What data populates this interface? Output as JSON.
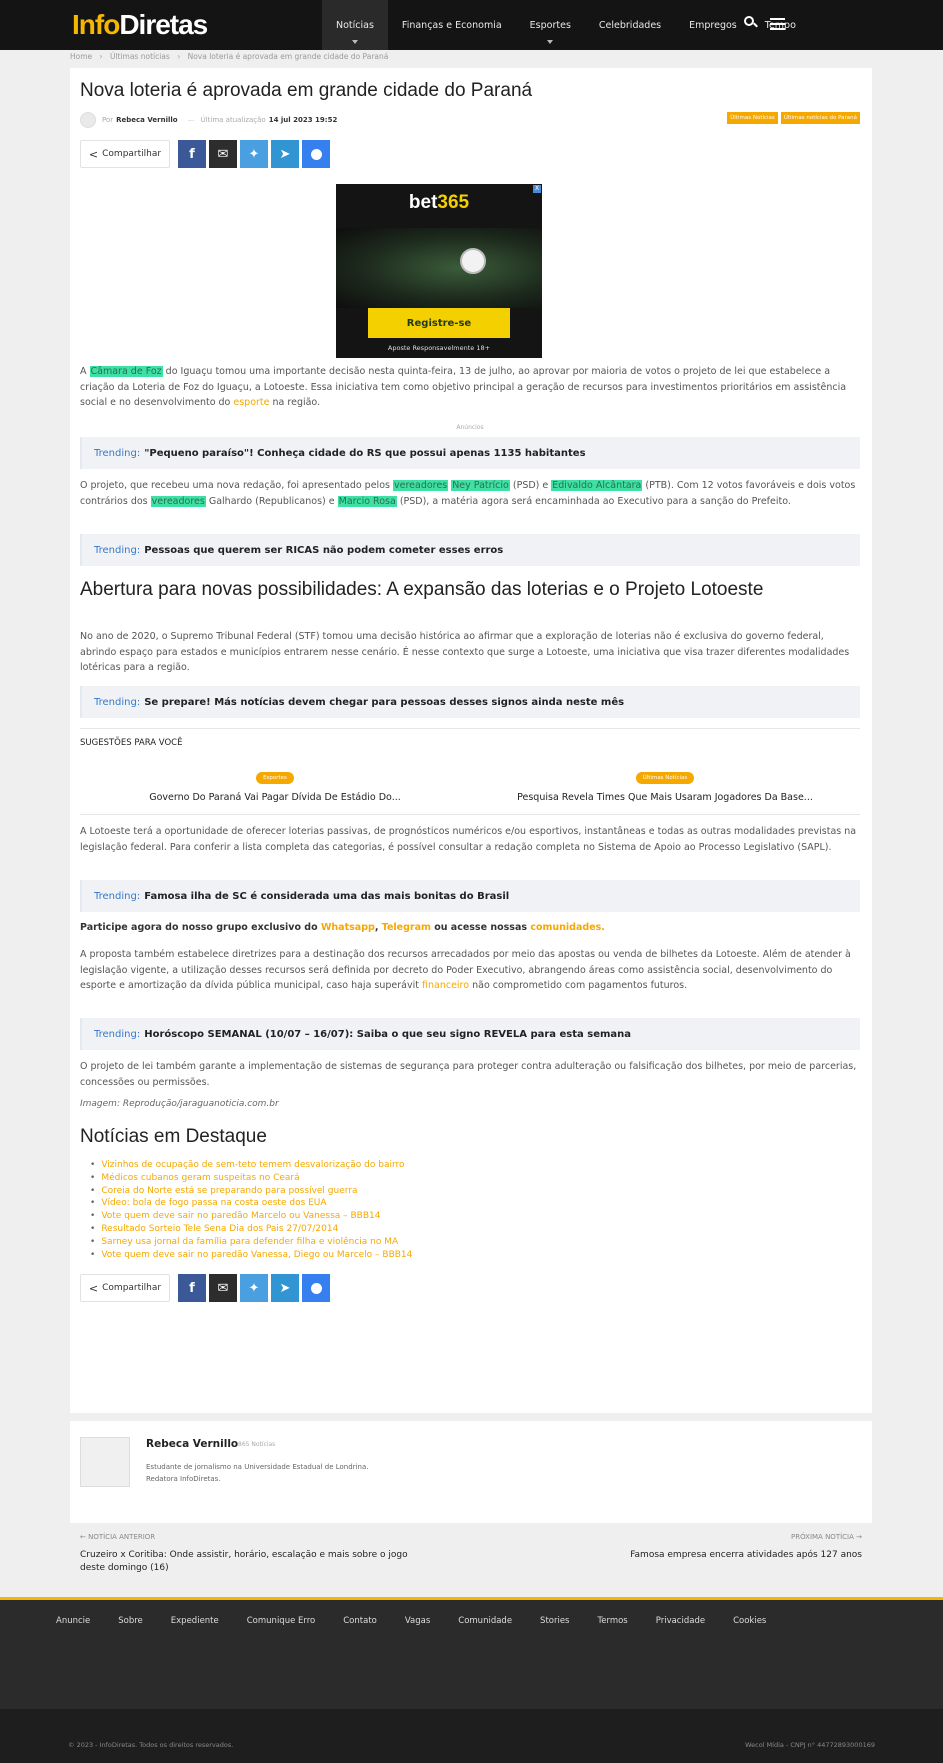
{
  "header": {
    "logo_part1": "Info",
    "logo_part2": "Diretas",
    "nav": [
      "Notícias",
      "Finanças e Economia",
      "Esportes",
      "Celebridades",
      "Empregos",
      "Tempo"
    ],
    "active_nav": "Notícias",
    "icons": [
      "search-icon",
      "hamburger-menu-icon"
    ]
  },
  "breadcrumb": [
    "Home",
    "›",
    "Últimas notícias",
    "›",
    "Nova loteria é aprovada em grande cidade do Paraná"
  ],
  "article": {
    "title": "Nova loteria é aprovada em grande cidade do Paraná",
    "by_prefix": "Por",
    "author": "Rebeca Vernillo",
    "updated_prefix": "Última atualização",
    "updated_date": "14 jul 2023 19:52",
    "tags": [
      "Últimas Notícias",
      "Últimas notícias do Paraná"
    ],
    "share_label": "Compartilhar",
    "p1_a": "A ",
    "p1_hl": "Câmara de Foz",
    "p1_b": " do Iguaçu tomou uma importante decisão nesta quinta-feira, 13 de julho, ao aprovar por maioria de votos o projeto de lei que estabelece a criação da Loteria de Foz do Iguaçu, a Lotoeste. Essa iniciativa tem como objetivo principal a geração de recursos para investimentos prioritários em assistência social e no desenvolvimento do ",
    "p1_link": "esporte",
    "p1_c": " na região.",
    "ads_label": "Anúncios",
    "p2_a": "O projeto, que recebeu uma nova redação, foi apresentado pelos ",
    "p2_hl1": "vereadores",
    "p2_b": " ",
    "p2_hl2": "Ney Patrício",
    "p2_c": " (PSD) e ",
    "p2_hl3": "Edivaldo Alcântara",
    "p2_d": " (PTB). Com 12 votos favoráveis e dois votos contrários dos ",
    "p2_hl4": "vereadores",
    "p2_e": " Galhardo (Republicanos) e ",
    "p2_hl5": "Marcio Rosa",
    "p2_f": " (PSD), a matéria agora será encaminhada ao Executivo para a sanção do Prefeito.",
    "h2": "Abertura para novas possibilidades: A expansão das loterias e o Projeto Lotoeste",
    "p3": "No ano de 2020, o Supremo Tribunal Federal (STF) tomou uma decisão histórica ao afirmar que a exploração de loterias não é exclusiva do governo federal, abrindo espaço para estados e municípios entrarem nesse cenário. É nesse contexto que surge a Lotoeste, uma iniciativa que visa trazer diferentes modalidades lotéricas para a região.",
    "suggestions_title": "SUGESTÕES PARA VOCÊ",
    "suggestions": [
      {
        "badge": "Esportes",
        "title": "Governo Do Paraná Vai Pagar Dívida De Estádio Do..."
      },
      {
        "badge": "Últimas Notícias",
        "title": "Pesquisa Revela Times Que Mais Usaram Jogadores Da Base..."
      }
    ],
    "p4": "A Lotoeste terá a oportunidade de oferecer loterias passivas, de prognósticos numéricos e/ou esportivos, instantâneas e todas as outras modalidades previstas na legislação federal. Para conferir a lista completa das categorias, é possível consultar a redação completa no Sistema de Apoio ao Processo Legislativo (SAPL).",
    "join_a": "Participe agora do nosso grupo exclusivo do ",
    "join_wa": "Whatsapp",
    "join_b": ", ",
    "join_tg": "Telegram",
    "join_c": " ou acesse nossas ",
    "join_com": "comunidades.",
    "p5_a": "A proposta também estabelece diretrizes para a destinação dos recursos arrecadados por meio das apostas ou venda de bilhetes da Lotoeste. Além de atender à legislação vigente, a utilização desses recursos será definida por decreto do Poder Executivo, abrangendo áreas como assistência social, desenvolvimento do esporte e amortização da dívida pública municipal, caso haja superávit ",
    "p5_link": "financeiro",
    "p5_b": " não comprometido com pagamentos futuros.",
    "p6": "O projeto de lei também garante a implementação de sistemas de segurança para proteger contra adulteração ou falsificação dos bilhetes, por meio de parcerias, concessões ou permissões.",
    "credit": "Imagem: Reprodução/jaraguanoticia.com.br"
  },
  "trending": {
    "label": "Trending:",
    "items": [
      "\"Pequeno paraíso\"! Conheça cidade do RS que possui apenas 1135 habitantes",
      "Pessoas que querem ser RICAS não podem cometer esses erros",
      "Se prepare! Más notícias devem chegar para pessoas desses signos ainda neste mês",
      "Famosa ilha de SC é considerada uma das mais bonitas do Brasil",
      "Horóscopo SEMANAL (10/07 – 16/07): Saiba o que seu signo REVELA para esta semana"
    ]
  },
  "ad": {
    "brand_a": "bet",
    "brand_b": "365",
    "cta": "Registre-se",
    "disclaimer": "Aposte Responsavelmente   18+",
    "close": "X"
  },
  "featured": {
    "title": "Notícias em Destaque",
    "items": [
      "Vizinhos de ocupação de sem-teto temem desvalorização do bairro",
      "Médicos cubanos geram suspeitas no Ceará",
      "Coreia do Norte está se preparando para possível guerra",
      "Vídeo: bola de fogo passa na costa oeste dos EUA",
      "Vote quem deve sair no paredão Marcelo ou Vanessa – BBB14",
      "Resultado Sorteio Tele Sena Dia dos Pais 27/07/2014",
      "Sarney usa jornal da família para defender filha e violência no MA",
      "Vote quem deve sair no paredão Vanessa, Diego ou Marcelo – BBB14"
    ]
  },
  "author_box": {
    "name": "Rebeca Vernillo",
    "count": "865 Notícias",
    "bio_1": "Estudante de jornalismo na Universidade Estadual de Londrina.",
    "bio_2": "Redatora InfoDiretas."
  },
  "prevnext": {
    "prev_label": "←  NOTÍCIA ANTERIOR",
    "prev_title": "Cruzeiro x Coritiba: Onde assistir, horário, escalação e mais sobre o jogo deste domingo (16)",
    "next_label": "PRÓXIMA NOTÍCIA  →",
    "next_title": "Famosa empresa encerra atividades após 127 anos"
  },
  "footer": {
    "links": [
      "Anuncie",
      "Sobre",
      "Expediente",
      "Comunique Erro",
      "Contato",
      "Vagas",
      "Comunidade",
      "Stories",
      "Termos",
      "Privacidade",
      "Cookies"
    ],
    "copyright": "© 2023 - InfoDiretas. Todos os direitos reservados.",
    "company": "Wecol Mídia - CNPJ n° 44772893000169"
  },
  "colors": {
    "accent": "#f5b700",
    "highlight": "#3ee0a3",
    "trending_label": "#3579c8",
    "header_bg": "#141414"
  }
}
